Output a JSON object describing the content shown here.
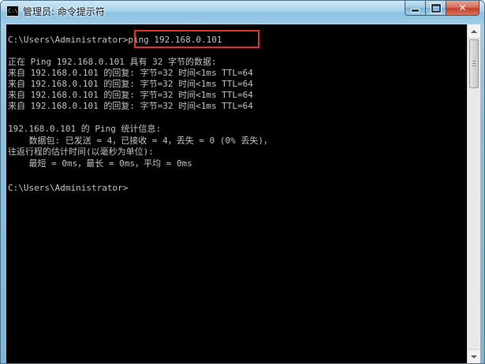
{
  "window": {
    "title": "管理员: 命令提示符",
    "icon": "cmd-window-icon",
    "icon_glyph": "C:\\",
    "controls": {
      "minimize": "minimize-icon",
      "maximize": "maximize-icon",
      "close_glyph": "✕"
    }
  },
  "console": {
    "lines": [
      "C:\\Users\\Administrator>ping 192.168.0.101",
      "",
      "正在 Ping 192.168.0.101 具有 32 字节的数据:",
      "来自 192.168.0.101 的回复: 字节=32 时间<1ms TTL=64",
      "来自 192.168.0.101 的回复: 字节=32 时间<1ms TTL=64",
      "来自 192.168.0.101 的回复: 字节=32 时间<1ms TTL=64",
      "来自 192.168.0.101 的回复: 字节=32 时间<1ms TTL=64",
      "",
      "192.168.0.101 的 Ping 统计信息:",
      "    数据包: 已发送 = 4，已接收 = 4，丢失 = 0 (0% 丢失)，",
      "往返行程的估计时间(以毫秒为单位):",
      "    最短 = 0ms，最长 = 0ms，平均 = 0ms",
      "",
      "C:\\Users\\Administrator>"
    ]
  },
  "colors": {
    "console_bg": "#000000",
    "console_fg": "#c0c0c0",
    "highlight_box": "#e0302a",
    "close_button": "#c4412a"
  }
}
